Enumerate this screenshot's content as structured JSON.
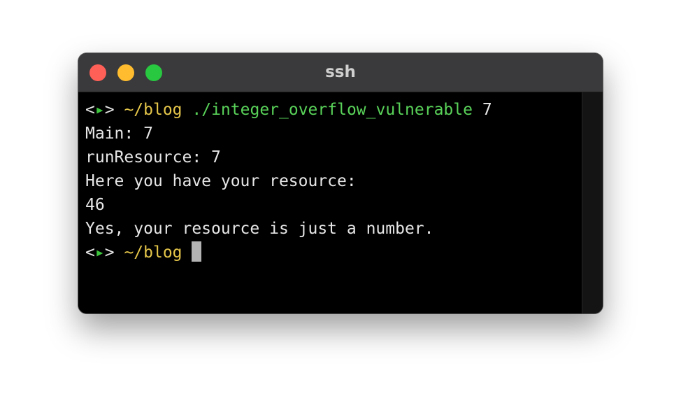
{
  "window": {
    "title": "ssh"
  },
  "colors": {
    "prompt_symbol": "#e6e6e6",
    "prompt_arrow": "#3ec53e",
    "path": "#e5c64a",
    "command": "#59d259",
    "output": "#e6e6e6"
  },
  "terminal": {
    "line1": {
      "prompt_open": "<",
      "prompt_arrow": "▸",
      "prompt_close": ">",
      "path": "~/blog",
      "command": "./integer_overflow_vulnerable",
      "argument": "7"
    },
    "output": [
      "Main: 7",
      "runResource: 7",
      "Here you have your resource:",
      "46",
      "Yes, your resource is just a number."
    ],
    "line7": {
      "prompt_open": "<",
      "prompt_arrow": "▸",
      "prompt_close": ">",
      "path": "~/blog"
    }
  }
}
